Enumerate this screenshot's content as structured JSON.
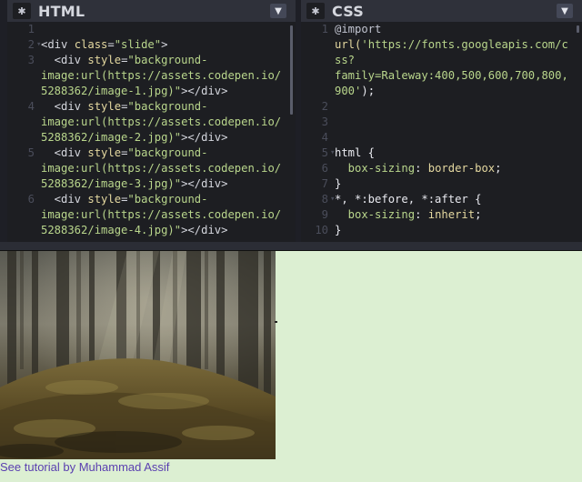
{
  "html_pane": {
    "title": "HTML",
    "gear_icon": "gear-icon",
    "chevron_icon": "chevron-down-icon",
    "lines": [
      {
        "num": "1",
        "fold": "",
        "segments": []
      },
      {
        "num": "2",
        "fold": "▾",
        "segments": [
          {
            "cls": "tag",
            "t": "<div "
          },
          {
            "cls": "attr",
            "t": "class"
          },
          {
            "cls": "tag",
            "t": "="
          },
          {
            "cls": "str",
            "t": "\"slide\""
          },
          {
            "cls": "tag",
            "t": ">"
          }
        ]
      },
      {
        "num": "3",
        "fold": "",
        "segments": [
          {
            "cls": "tag",
            "t": "  <div "
          },
          {
            "cls": "attr",
            "t": "style"
          },
          {
            "cls": "tag",
            "t": "="
          },
          {
            "cls": "str",
            "t": "\"background-"
          }
        ]
      },
      {
        "num": "",
        "fold": "",
        "segments": [
          {
            "cls": "str",
            "t": "image:url(https://assets.codepen.io/"
          }
        ]
      },
      {
        "num": "",
        "fold": "",
        "segments": [
          {
            "cls": "str",
            "t": "5288362/image-1.jpg)\""
          },
          {
            "cls": "tag",
            "t": "></div>"
          }
        ]
      },
      {
        "num": "4",
        "fold": "",
        "segments": [
          {
            "cls": "tag",
            "t": "  <div "
          },
          {
            "cls": "attr",
            "t": "style"
          },
          {
            "cls": "tag",
            "t": "="
          },
          {
            "cls": "str",
            "t": "\"background-"
          }
        ]
      },
      {
        "num": "",
        "fold": "",
        "segments": [
          {
            "cls": "str",
            "t": "image:url(https://assets.codepen.io/"
          }
        ]
      },
      {
        "num": "",
        "fold": "",
        "segments": [
          {
            "cls": "str",
            "t": "5288362/image-2.jpg)\""
          },
          {
            "cls": "tag",
            "t": "></div>"
          }
        ]
      },
      {
        "num": "5",
        "fold": "",
        "segments": [
          {
            "cls": "tag",
            "t": "  <div "
          },
          {
            "cls": "attr",
            "t": "style"
          },
          {
            "cls": "tag",
            "t": "="
          },
          {
            "cls": "str",
            "t": "\"background-"
          }
        ]
      },
      {
        "num": "",
        "fold": "",
        "segments": [
          {
            "cls": "str",
            "t": "image:url(https://assets.codepen.io/"
          }
        ]
      },
      {
        "num": "",
        "fold": "",
        "segments": [
          {
            "cls": "str",
            "t": "5288362/image-3.jpg)\""
          },
          {
            "cls": "tag",
            "t": "></div>"
          }
        ]
      },
      {
        "num": "6",
        "fold": "",
        "segments": [
          {
            "cls": "tag",
            "t": "  <div "
          },
          {
            "cls": "attr",
            "t": "style"
          },
          {
            "cls": "tag",
            "t": "="
          },
          {
            "cls": "str",
            "t": "\"background-"
          }
        ]
      },
      {
        "num": "",
        "fold": "",
        "segments": [
          {
            "cls": "str",
            "t": "image:url(https://assets.codepen.io/"
          }
        ]
      },
      {
        "num": "",
        "fold": "",
        "segments": [
          {
            "cls": "str",
            "t": "5288362/image-4.jpg)\""
          },
          {
            "cls": "tag",
            "t": "></div>"
          }
        ]
      }
    ]
  },
  "css_pane": {
    "title": "CSS",
    "gear_icon": "gear-icon",
    "chevron_icon": "chevron-down-icon",
    "lines": [
      {
        "num": "1",
        "fold": "",
        "segments": [
          {
            "cls": "kw",
            "t": "@import"
          }
        ]
      },
      {
        "num": "",
        "fold": "",
        "segments": [
          {
            "cls": "val",
            "t": "url("
          },
          {
            "cls": "str",
            "t": "'https://fonts.googleapis.com/c"
          }
        ]
      },
      {
        "num": "",
        "fold": "",
        "segments": [
          {
            "cls": "str",
            "t": "ss?"
          }
        ]
      },
      {
        "num": "",
        "fold": "",
        "segments": [
          {
            "cls": "str",
            "t": "family=Raleway:400,500,600,700,800,"
          }
        ]
      },
      {
        "num": "",
        "fold": "",
        "segments": [
          {
            "cls": "str",
            "t": "900'"
          },
          {
            "cls": "sel",
            "t": ");"
          }
        ]
      },
      {
        "num": "2",
        "fold": "",
        "segments": []
      },
      {
        "num": "3",
        "fold": "",
        "segments": []
      },
      {
        "num": "4",
        "fold": "",
        "segments": []
      },
      {
        "num": "5",
        "fold": "▾",
        "segments": [
          {
            "cls": "sel",
            "t": "html {"
          }
        ]
      },
      {
        "num": "6",
        "fold": "",
        "segments": [
          {
            "cls": "prop",
            "t": "  box-sizing"
          },
          {
            "cls": "sel",
            "t": ": "
          },
          {
            "cls": "val",
            "t": "border-box"
          },
          {
            "cls": "sel",
            "t": ";"
          }
        ]
      },
      {
        "num": "7",
        "fold": "",
        "segments": [
          {
            "cls": "sel",
            "t": "}"
          }
        ]
      },
      {
        "num": "8",
        "fold": "▾",
        "segments": [
          {
            "cls": "sel",
            "t": "*, *:before, *:after {"
          }
        ]
      },
      {
        "num": "9",
        "fold": "",
        "segments": [
          {
            "cls": "prop",
            "t": "  box-sizing"
          },
          {
            "cls": "sel",
            "t": ": "
          },
          {
            "cls": "val",
            "t": "inherit"
          },
          {
            "cls": "sel",
            "t": ";"
          }
        ]
      },
      {
        "num": "10",
        "fold": "",
        "segments": [
          {
            "cls": "sel",
            "t": "}"
          }
        ]
      }
    ]
  },
  "preview": {
    "tutorial_link": "See tutorial by Muhammad Assif",
    "background": "#dcefd2",
    "link_color": "#5a3fb0"
  }
}
